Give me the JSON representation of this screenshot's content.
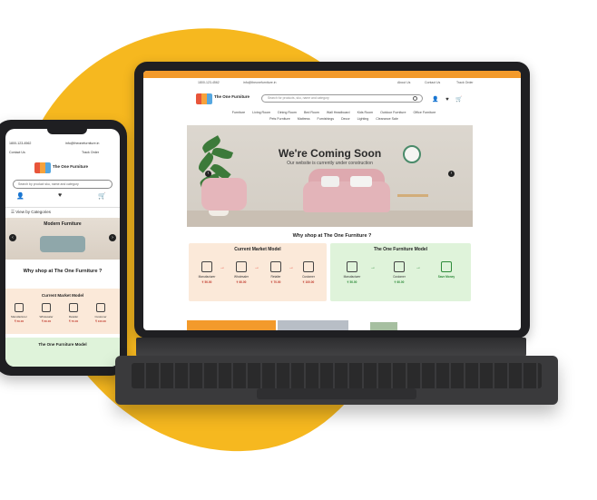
{
  "laptop": {
    "topbar_text": "Special offer announcement bar",
    "contact": {
      "phone": "1800-123-4562",
      "email": "info@theonefurniture.in",
      "about": "About Us",
      "contact": "Contact Us",
      "track": "Track Order"
    },
    "logo": {
      "name": "The One Furniture"
    },
    "search": {
      "placeholder": "Search for products, sku, name and category"
    },
    "header_icons": "👤 ♥ 🛒",
    "nav": [
      "Furniture",
      "Living Room",
      "Dining Room",
      "Bed Room",
      "Wall Headboard",
      "Kids Room",
      "Outdoor Furniture",
      "Office Furniture",
      "Pets Furniture",
      "Mattress",
      "Furnishings",
      "Decor",
      "Lighting",
      "Clearance Sale"
    ],
    "hero": {
      "title": "We're Coming Soon",
      "subtitle": "Our website is currently under construction",
      "prev": "‹",
      "next": "›"
    },
    "why_title": "Why shop at The One Furniture ?",
    "current_model": {
      "title": "Current Market Model",
      "steps": [
        {
          "label": "Manufacturer",
          "price": "₹ 50.00"
        },
        {
          "label": "Wholesaler",
          "price": "₹ 60.00"
        },
        {
          "label": "Retailer",
          "price": "₹ 70.00"
        },
        {
          "label": "Customer",
          "price": "₹ 100.00"
        }
      ]
    },
    "one_model": {
      "title": "The One Furniture Model",
      "steps": [
        {
          "label": "Manufacturer",
          "price": "₹ 50.00"
        },
        {
          "label": "Customer",
          "price": "₹ 60.00"
        },
        {
          "label": "Save Money",
          "price": ""
        }
      ]
    },
    "arrow": "→"
  },
  "phone": {
    "contact": {
      "phone": "1800-123-4562",
      "email": "info@theonefurniture.in",
      "contact": "Contact Us",
      "track": "Track Order"
    },
    "logo": {
      "name": "The One Furniture"
    },
    "search": {
      "placeholder": "Search by product sku, name and category"
    },
    "cart_count": "0",
    "wish_count": "0",
    "categories": "☰  View by Categories",
    "hero_title": "Modern Furniture",
    "why_title": "Why shop at The One Furniture ?",
    "current_model": {
      "title": "Current Market Model",
      "steps": [
        {
          "label": "Manufacturer",
          "price": "₹ 50.00"
        },
        {
          "label": "Wholesaler",
          "price": "₹ 60.00"
        },
        {
          "label": "Retailer",
          "price": "₹ 70.00"
        },
        {
          "label": "Customer",
          "price": "₹ 100.00"
        }
      ]
    },
    "one_model_title": "The One Furniture Model"
  }
}
